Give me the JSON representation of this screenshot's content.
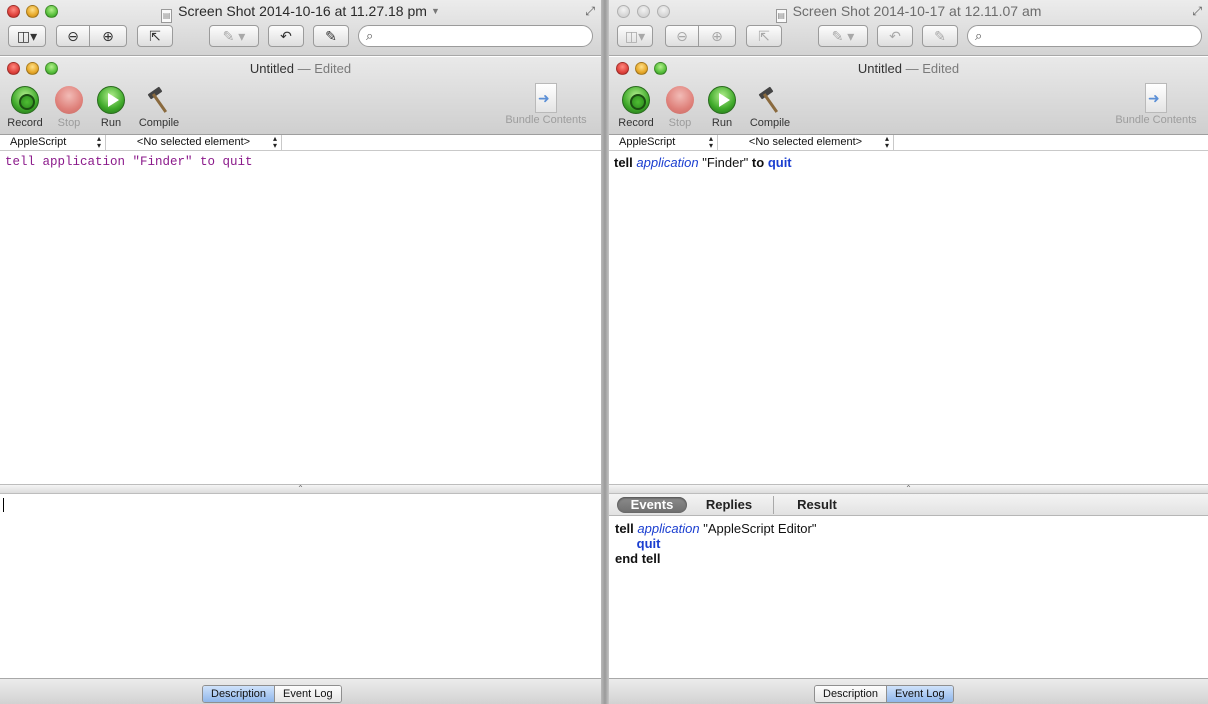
{
  "left": {
    "preview_title": "Screen Shot 2014-10-16 at 11.27.18 pm",
    "search_value": "",
    "editor_title": "Untitled",
    "editor_title_suffix": "— Edited",
    "toolbar": {
      "record": "Record",
      "stop": "Stop",
      "run": "Run",
      "compile": "Compile",
      "bundle": "Bundle Contents"
    },
    "language_select": "AppleScript",
    "element_select": "<No selected element>",
    "script_text": "tell application \"Finder\" to quit",
    "footer_tabs": [
      "Description",
      "Event Log"
    ],
    "footer_active": "Description"
  },
  "right": {
    "preview_title": "Screen Shot 2014-10-17 at 12.11.07 am",
    "search_value": "",
    "editor_title": "Untitled",
    "editor_title_suffix": "— Edited",
    "toolbar": {
      "record": "Record",
      "stop": "Stop",
      "run": "Run",
      "compile": "Compile",
      "bundle": "Bundle Contents"
    },
    "language_select": "AppleScript",
    "element_select": "<No selected element>",
    "script": {
      "tell": "tell",
      "application": "application",
      "target": "\"Finder\"",
      "to": "to",
      "quit": "quit"
    },
    "log_tabs": [
      "Events",
      "Replies",
      "Result"
    ],
    "log_active": "Events",
    "event_log": {
      "line1_tell": "tell",
      "line1_class": "application",
      "line1_target": "\"AppleScript Editor\"",
      "line2_cmd": "quit",
      "line3_end": "end tell"
    },
    "footer_tabs": [
      "Description",
      "Event Log"
    ],
    "footer_active": "Event Log"
  },
  "colors": {
    "keyword_blue": "#1a3ed0",
    "raw_script_purple": "#8b1a8b",
    "selected_segment": "#8fb6ea"
  },
  "icons": [
    "sidebar-toggle-icon",
    "zoom-out-icon",
    "zoom-in-icon",
    "share-icon",
    "markup-pen-icon",
    "rotate-icon",
    "edit-icon",
    "search-icon",
    "record-icon",
    "stop-icon",
    "run-icon",
    "compile-hammer-icon",
    "bundle-contents-icon",
    "fullscreen-icon"
  ]
}
